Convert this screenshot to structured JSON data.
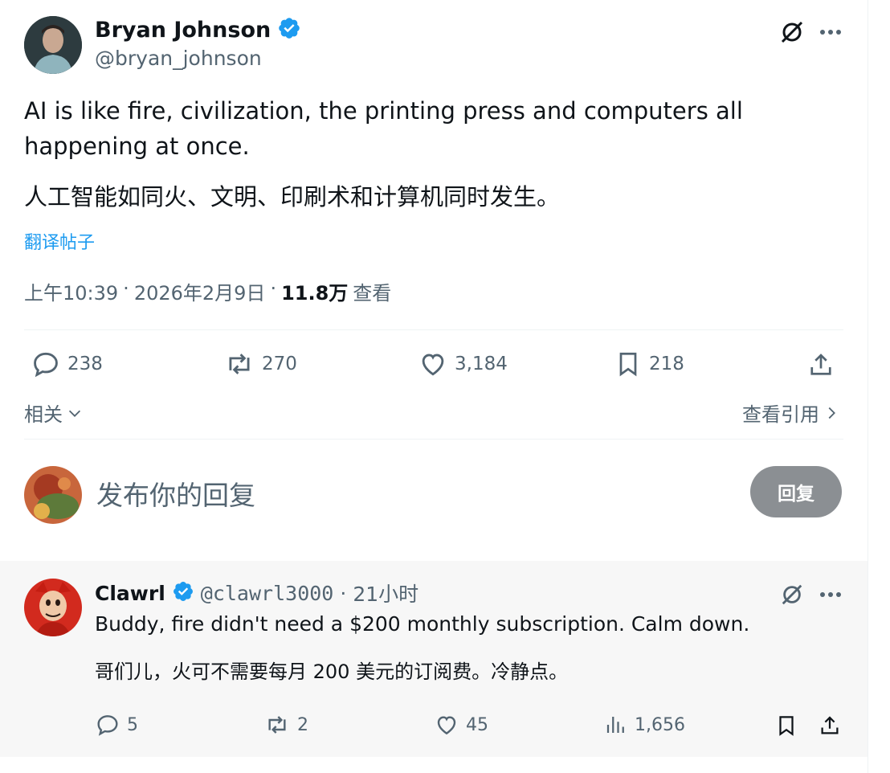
{
  "tweet": {
    "author_name": "Bryan Johnson",
    "author_handle": "@bryan_johnson",
    "text_en": "AI is like fire, civilization, the printing press and computers all happening at once.",
    "text_cn": "人工智能如同火、文明、印刷术和计算机同时发生。",
    "translate_label": "翻译帖子",
    "time": "上午10:39",
    "separator": "·",
    "date": "2026年2月9日",
    "views_count": "11.8万",
    "views_label": "查看",
    "replies": "238",
    "reposts": "270",
    "likes": "3,184",
    "bookmarks": "218"
  },
  "related": {
    "label": "相关",
    "quotes_label": "查看引用"
  },
  "composer": {
    "placeholder": "发布你的回复",
    "button_label": "回复"
  },
  "reply": {
    "author_name": "Clawrl",
    "author_handle": "@clawrl3000",
    "separator": "·",
    "time": "21小时",
    "text_en": "Buddy, fire didn't need a $200 monthly subscription. Calm down.",
    "text_cn": "哥们儿，火可不需要每月 200 美元的订阅费。冷静点。",
    "replies": "5",
    "reposts": "2",
    "likes": "45",
    "views": "1,656"
  },
  "colors": {
    "accent": "#1d9bf0",
    "text": "#0f1419",
    "muted": "#536471",
    "reply_button": "#8b8f93",
    "reply_bg": "#f7f7f7"
  },
  "icons": [
    "grok-icon",
    "more-icon",
    "verified-icon",
    "reply-icon",
    "repost-icon",
    "like-icon",
    "bookmark-icon",
    "share-icon",
    "chevron-down-icon",
    "chevron-right-icon",
    "views-icon"
  ]
}
